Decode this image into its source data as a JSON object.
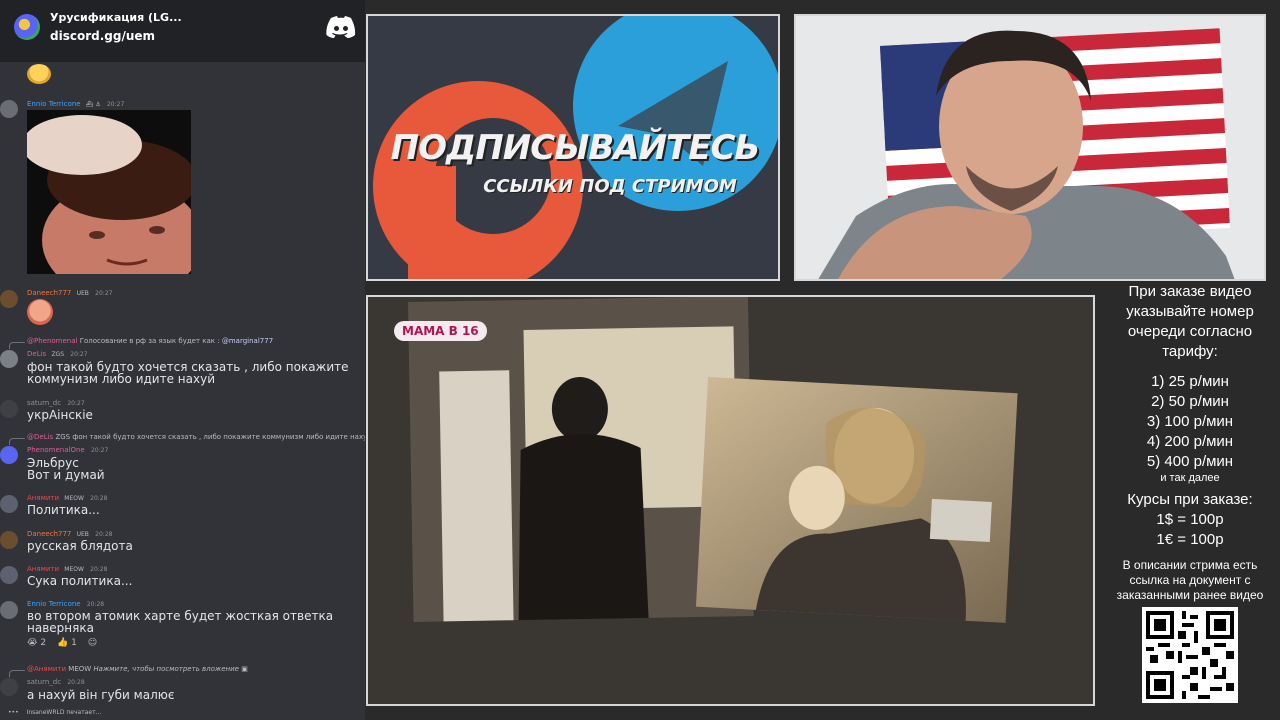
{
  "discord": {
    "server_name": "Урусификация (LG...",
    "server_link": "discord.gg/uem",
    "logo": "discord-icon",
    "messages": [
      {
        "user": "Ennio Terricone",
        "time": "20:27",
        "name_color": "#3ba5ff",
        "attachment": "meme-image"
      },
      {
        "user": "Daneech777",
        "badge": "UEB",
        "time": "20:27",
        "name_color": "#f0743c",
        "attachment": "angry-emoji"
      },
      {
        "reply_user": "@Phenomenal",
        "reply_text": "Голосование в рф за язык будет как :",
        "reply_mention": "@marginal777",
        "user": "DeLis",
        "badge": "ZGS",
        "time": "20:27",
        "name_color": "#e05e9b",
        "text": "фон такой будто хочется сказать , либо покажите\nкоммунизм либо идите нахуй"
      },
      {
        "user": "saturn_dc",
        "time": "20:27",
        "name_color": "#8e9297",
        "text": "укрАінскіе"
      },
      {
        "reply_user": "@DeLis",
        "reply_badge": "ZGS",
        "reply_text": "фон такой будто хочется сказать , либо покажите коммунизм либо идите нахуй",
        "user": "PhenomenalOne",
        "time": "20:27",
        "name_color": "#e05e9b",
        "text": "Эльбрус\nВот и думай"
      },
      {
        "user": "Анямити",
        "badge": "MEOW",
        "time": "20:28",
        "name_color": "#f04747",
        "text": "Политика..."
      },
      {
        "user": "Daneech777",
        "badge": "UEB",
        "time": "20:28",
        "name_color": "#f0743c",
        "text": "русская блядота"
      },
      {
        "user": "Анямити",
        "badge": "MEOW",
        "time": "20:28",
        "name_color": "#f04747",
        "text": "Сука политика..."
      },
      {
        "user": "Ennio Terricone",
        "time": "20:28",
        "name_color": "#3ba5ff",
        "text": "во втором атомик харте будет жосткая ответка\nнаверняка",
        "reactions": [
          "2",
          "1"
        ]
      },
      {
        "reply_user": "@Анямити",
        "reply_badge": "MEOW",
        "reply_text": "Нажмите, чтобы посмотреть вложение",
        "user": "saturn_dc",
        "time": "20:28",
        "name_color": "#8e9297",
        "text": "а нахуй він губи малює"
      }
    ],
    "typing": "InsaneWRLD печатает..."
  },
  "promo": {
    "title": "ПОДПИСЫВАЙТЕСЬ",
    "subtitle": "ССЫЛКИ ПОД СТРИМОМ",
    "colors": {
      "patreon": "#e8583a",
      "telegram": "#2a9fd9"
    }
  },
  "video": {
    "show_badge": "МАМА В 16"
  },
  "info": {
    "order_note": "При заказе видео указывайте номер очереди согласно тарифу:",
    "tariffs": [
      "1) 25 р/мин",
      "2) 50 р/мин",
      "3) 100 р/мин",
      "4) 200 р/мин",
      "5) 400 р/мин"
    ],
    "etc": "и так далее",
    "rates_title": "Курсы при заказе:",
    "rates": [
      "1$ = 100р",
      "1€ = 100р"
    ],
    "description_note": "В описании стрима есть ссылка на документ с заказанными ранее видео"
  }
}
